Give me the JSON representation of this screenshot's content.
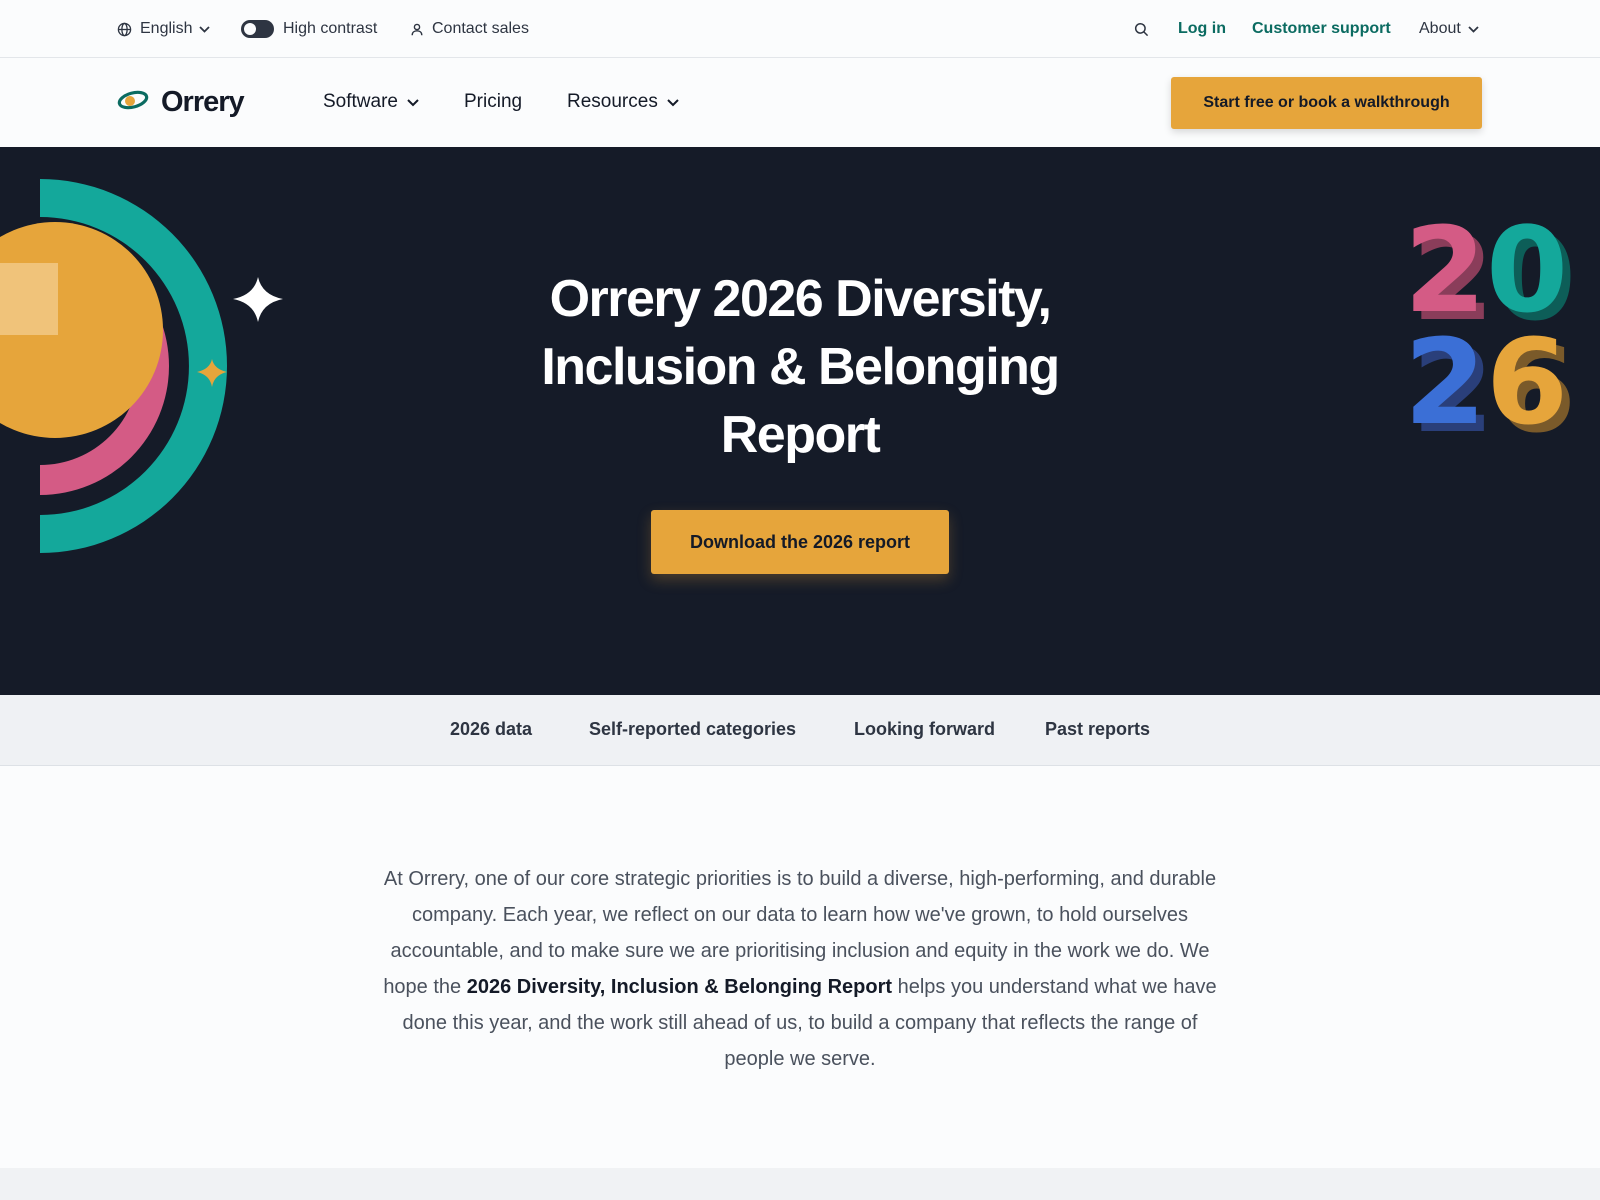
{
  "utility": {
    "language": "English",
    "contrast_label": "High contrast",
    "contact_label": "Contact sales",
    "login": "Log in",
    "support": "Customer support",
    "about": "About"
  },
  "nav": {
    "brand": "Orrery",
    "software": "Software",
    "pricing": "Pricing",
    "resources": "Resources",
    "cta": "Start free or book a walkthrough"
  },
  "hero": {
    "title": "Orrery 2026 Diversity, Inclusion & Belonging Report",
    "cta": "Download the 2026 report",
    "year_digits": [
      "2",
      "0",
      "2",
      "6"
    ]
  },
  "tabs": [
    "2026 data",
    "Self-reported categories",
    "Looking forward",
    "Past reports"
  ],
  "intro": {
    "before": "At Orrery, one of our core strategic priorities is to build a diverse, high-performing, and durable company. Each year, we reflect on our data to learn how we've grown, to hold ourselves accountable, and to make sure we are prioritising inclusion and equity in the work we do. We hope the ",
    "emphasis": "2026 Diversity, Inclusion & Belonging Report",
    "after": " helps you understand what we have done this year, and the work still ahead of us, to build a company that reflects the range of people we serve."
  },
  "colors": {
    "accent": "#e6a53b",
    "teal": "#0b6b61",
    "hero_bg": "#151b28",
    "pink": "#d45b85",
    "aqua": "#14a89b",
    "blue": "#3b6fd6"
  },
  "icons": [
    "globe-icon",
    "chevron-down-icon",
    "toggle-icon",
    "person-icon",
    "search-icon",
    "orbit-logo-icon",
    "sparkle-icon"
  ]
}
